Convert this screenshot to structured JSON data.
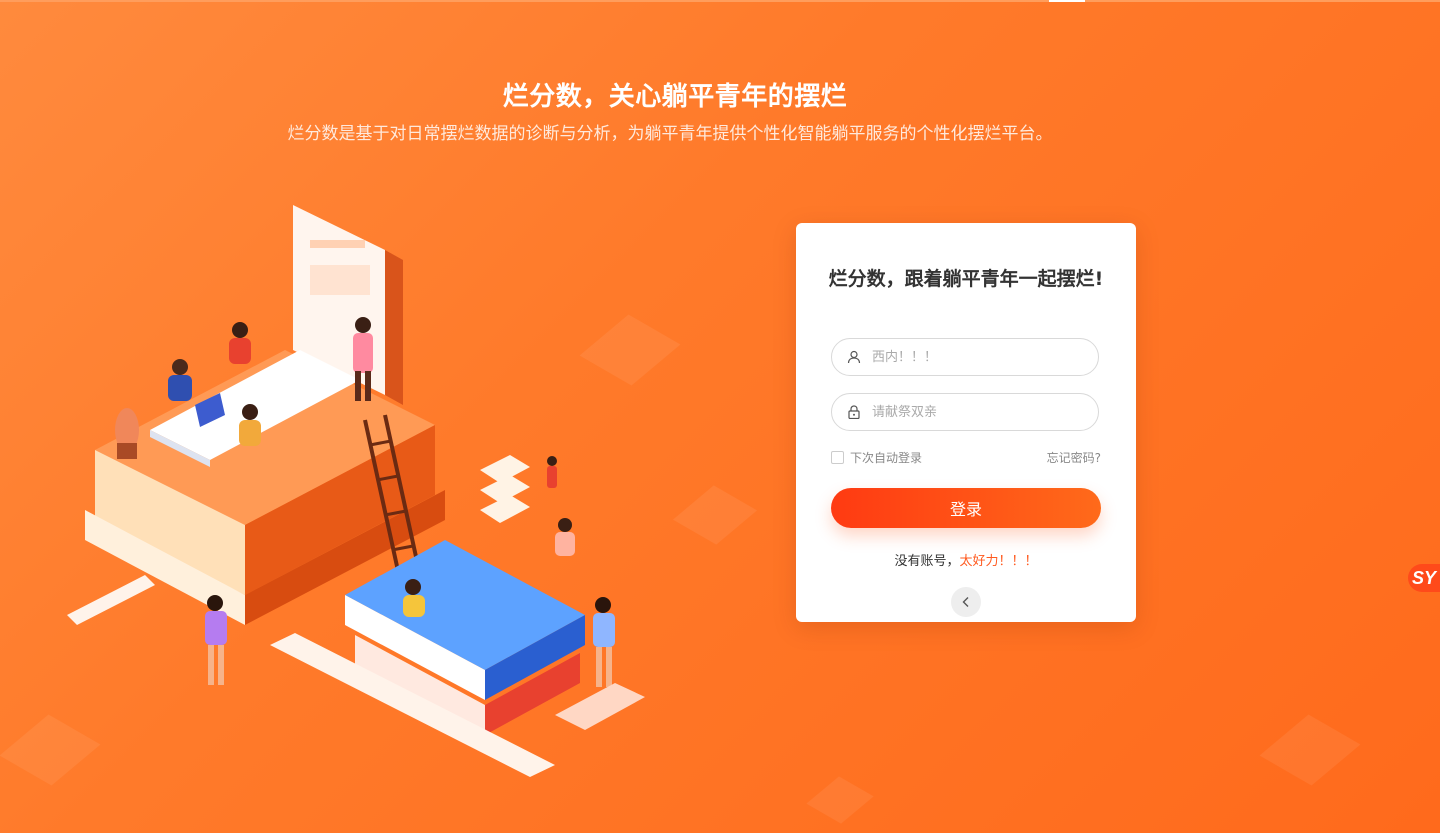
{
  "hero": {
    "title": "烂分数，关心躺平青年的摆烂",
    "subtitle": "烂分数是基于对日常摆烂数据的诊断与分析，为躺平青年提供个性化智能躺平服务的个性化摆烂平台。"
  },
  "login": {
    "title": "烂分数，跟着躺平青年一起摆烂!",
    "username_placeholder": "西内！！！",
    "password_placeholder": "请献祭双亲",
    "remember_label": "下次自动登录",
    "forgot_label": "忘记密码?",
    "submit_label": "登录",
    "register_prefix": "没有账号，",
    "register_link": "太好力！！！",
    "back_icon": "chevron-left-icon"
  },
  "side_logo": {
    "text": "SY"
  },
  "colors": {
    "background": "#ff7a2a",
    "button_start": "#ff3a12",
    "button_end": "#ff6a1a",
    "link": "#ff5a1f"
  }
}
